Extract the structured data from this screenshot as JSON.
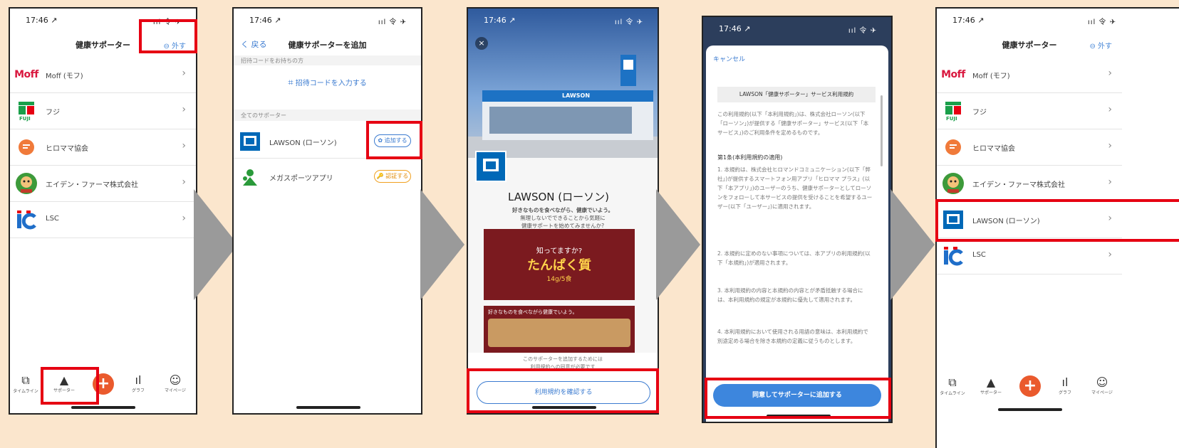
{
  "colors": {
    "background": "#fbe6cd",
    "highlight": "#e60012",
    "accent_blue": "#3b7bd0",
    "add_button": "#ea5a2d",
    "arrow": "#9a9a9a"
  },
  "status": {
    "time": "17:46 ↗",
    "signal": "ııl 令 ✈"
  },
  "screen1": {
    "title": "健康サポーター",
    "edit_label": "⊖ 外す",
    "items": [
      {
        "logo": "Moff",
        "label": "Moff (モフ)"
      },
      {
        "logo": "FUJI",
        "label": "フジ"
      },
      {
        "logo": "hiramama-icon",
        "label": "ヒロママ協会"
      },
      {
        "logo": "green-character-icon",
        "label": "エイデン・ファーマ株式会社"
      },
      {
        "logo": "LC",
        "label": "LSC"
      }
    ],
    "tabs": [
      "タイムライン",
      "サポーター",
      "",
      "グラフ",
      "マイページ"
    ]
  },
  "screen2": {
    "back": "く 戻る",
    "title": "健康サポーターを追加",
    "code_section": "招待コードをお持ちの方",
    "code_button": "招待コードを入力する",
    "all_section": "全てのサポーター",
    "items": [
      {
        "label": "LAWSON (ローソン)",
        "action": "✿ 追加する"
      },
      {
        "label": "メガスポーツアプリ",
        "action": "🔑 認証する"
      }
    ]
  },
  "screen3": {
    "store_sign": "LAWSON",
    "heading": "LAWSON (ローソン)",
    "intro_1": "好きなものを食べながら、健康でいよう。",
    "intro_2": "無理しないでできることから気軽に",
    "intro_3": "健康サポートを始めてみませんか?",
    "banner1_line1": "知ってますか?",
    "banner1_line2": "たんぱく質",
    "banner1_line3": "14g/5食",
    "banner2": "好きなものを食べながら健康でいよう。",
    "footer_1": "このサポーターを追加するためには",
    "footer_2": "利用規約への同意が必要です",
    "button": "利用規約を確認する"
  },
  "screen4": {
    "cancel": "キャンセル",
    "doc_title": "LAWSON「健康サポーター」サービス利用規約",
    "para1": "この利用規約(以下「本利用規約」)は、株式会社ローソン(以下「ローソン」)が提供する「健康サポーター」サービス(以下「本サービス」)のご利用条件を定めるものです。",
    "article1": "第1条(本利用規約の適用)",
    "para2": "1. 本規約は、株式会社ヒロマンドコミュニケーション(以下「弊社」)が提供するスマートフォン用アプリ「ヒロママ プラス」(以下「本アプリ」)のユーザーのうち、健康サポーターとしてローソンをフォローして本サービスの提供を受けることを希望するユーザー(以下「ユーザー」)に適用されます。",
    "para3": "2. 本規約に定めのない事項については、本アプリの利用規約(以下「本規約」)が適用されます。",
    "para4": "3. 本利用規約の内容と本規約の内容とが矛盾抵触する場合には、本利用規約の規定が本規約に優先して適用されます。",
    "para5": "4. 本利用規約において使用される用語の意味は、本利用規約で別途定める場合を除き本規約の定義に従うものとします。",
    "button": "同意してサポーターに追加する"
  },
  "screen5": {
    "title": "健康サポーター",
    "edit_label": "⊖ 外す",
    "items": [
      {
        "logo": "Moff",
        "label": "Moff (モフ)"
      },
      {
        "logo": "FUJI",
        "label": "フジ"
      },
      {
        "logo": "hiramama-icon",
        "label": "ヒロママ協会"
      },
      {
        "logo": "green-character-icon",
        "label": "エイデン・ファーマ株式会社"
      },
      {
        "logo": "lawson-icon",
        "label": "LAWSON (ローソン)"
      },
      {
        "logo": "LC",
        "label": "LSC"
      }
    ],
    "tabs": [
      "タイムライン",
      "サポーター",
      "",
      "グラフ",
      "マイページ"
    ]
  }
}
